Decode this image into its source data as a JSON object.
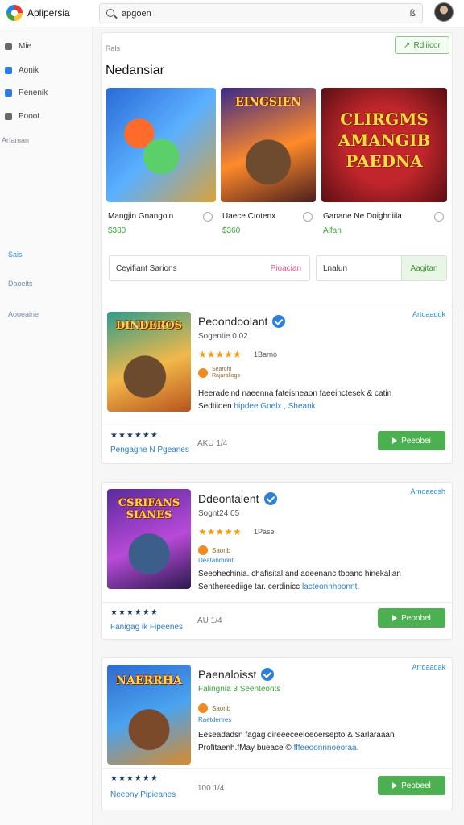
{
  "app": {
    "name": "Aplipersia"
  },
  "search": {
    "value": "apgoen",
    "clear_label": "ß"
  },
  "sidebar": {
    "items": [
      {
        "label": "Mie"
      },
      {
        "label": "Aonik"
      },
      {
        "label": "Penenik"
      },
      {
        "label": "Pooot"
      }
    ],
    "section_label": "Arfaman",
    "links": [
      {
        "label": "Sais"
      },
      {
        "label": "Daoeits"
      },
      {
        "label": "Aooeaine"
      }
    ]
  },
  "panel": {
    "breadcrumb": "Rals",
    "top_button": "Rdiiicor",
    "title": "Nedansiar",
    "featured": [
      {
        "title": "Mangjin Gnangoin",
        "price": "$380",
        "art_title": ""
      },
      {
        "title": "Uaece Ctotenx",
        "price": "$360",
        "art_title": "EINGSIEN"
      },
      {
        "title": "Ganane Ne Doighniila",
        "price": "Alfan",
        "art_title": "CLIRGMS AMANGIB PAEDNA"
      }
    ],
    "filter": {
      "label": "Ceyifiant Sarions",
      "pink_label": "Pioacian",
      "label2": "Lnalun",
      "apply_label": "Aagitan"
    }
  },
  "cards": [
    {
      "title": "Peoondoolant",
      "subtitle": "Sogentie 0 02",
      "stars": "★★★★★",
      "stars_text": "1Barno",
      "dot_text": "Searohi\nRajaraliogs",
      "desc_main": "Heeradeind naeenna fateisneaon faeeinctesek & catin",
      "desc_prefix": "Sedtiiden",
      "desc_link": "hipdee Goelx , Sheank",
      "top_link": "Artoaadok",
      "rating": "★★★★★★",
      "rating_text": "Pengagne N Pgeanes",
      "size_text": "AKU 1/4",
      "install": "Peeobei",
      "art_title": "DINDEROS"
    },
    {
      "title": "Ddeontalent",
      "subtitle": "Sognt24 05",
      "stars": "★★★★★",
      "stars_text": "1Pase",
      "dot_text": "Saonb",
      "dot_text2": "Deatanmont",
      "desc_main": "Seeohechinia. chafisital and adeenanc tbbanc hinekalian",
      "desc_prefix": "Senthereediige tar. cerdinicc",
      "desc_link": "lacteonnhoonnt.",
      "top_link": "Arnoaedsh",
      "rating": "★★★★★★",
      "rating_text": "Fanigag ik Fipeenes",
      "size_text": "AU 1/4",
      "install": "Peonbel",
      "art_title": "CSRIFANS SIANES"
    },
    {
      "title": "Paenaloisst",
      "subtitle": "Falingnia 3 Seenteonts",
      "stars": "",
      "stars_text": "",
      "dot_text": "Saonb",
      "dot_text2": "Raetdenres",
      "desc_main": "Eeseadadsn fagag direeeceeloeoersepto & Sarlaraaan",
      "desc_prefix": "Profitaenh.fMay bueace ©",
      "desc_link": "fffeeoonnnoeoraa.",
      "top_link": "Arroaadak",
      "rating": "★★★★★★",
      "rating_text": "Neeony Pipieanes",
      "size_text": "100 1/4",
      "install": "Peobeel",
      "art_title": "NAERRHA"
    }
  ]
}
